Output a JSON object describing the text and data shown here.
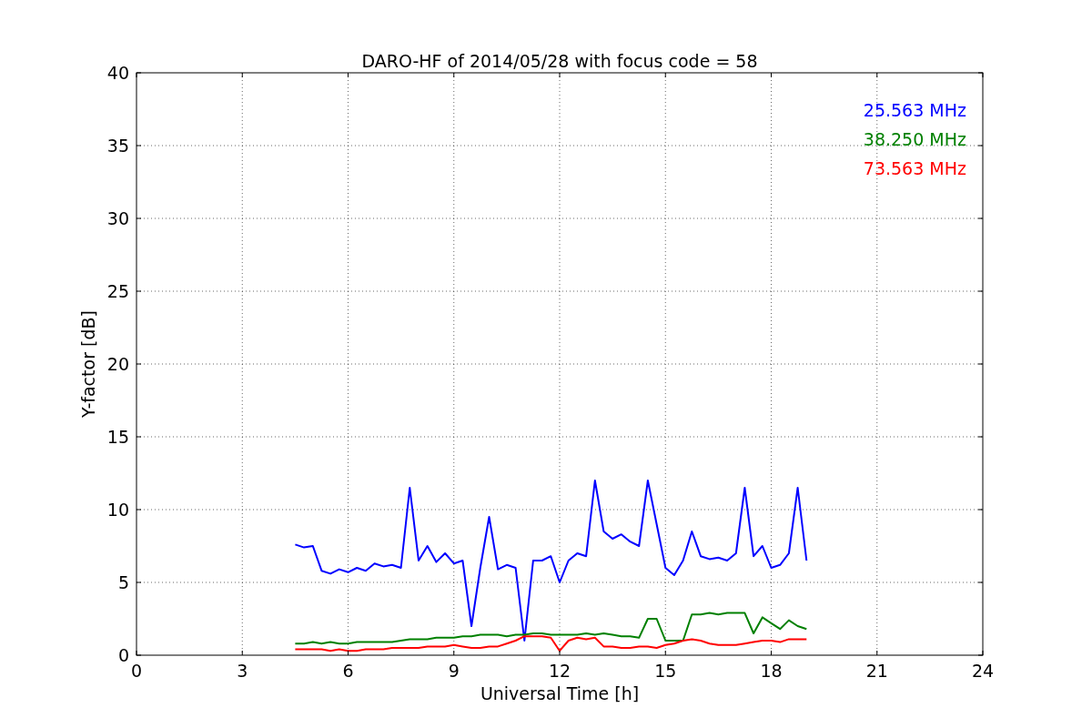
{
  "figure": {
    "chart_data": {
      "type": "line",
      "title": "DARO-HF of 2014/05/28 with focus code = 58",
      "xlabel": "Universal Time [h]",
      "ylabel": "Y-factor [dB]",
      "x": [
        4.5,
        4.75,
        5.0,
        5.25,
        5.5,
        5.75,
        6.0,
        6.25,
        6.5,
        6.75,
        7.0,
        7.25,
        7.5,
        7.75,
        8.0,
        8.25,
        8.5,
        8.75,
        9.0,
        9.25,
        9.5,
        9.75,
        10.0,
        10.25,
        10.5,
        10.75,
        11.0,
        11.25,
        11.5,
        11.75,
        12.0,
        12.25,
        12.5,
        12.75,
        13.0,
        13.25,
        13.5,
        13.75,
        14.0,
        14.25,
        14.5,
        14.75,
        15.0,
        15.25,
        15.5,
        15.75,
        16.0,
        16.25,
        16.5,
        16.75,
        17.0,
        17.25,
        17.5,
        17.75,
        18.0,
        18.25,
        18.5,
        18.75,
        19.0
      ],
      "series": [
        {
          "name": "25.563 MHz",
          "color": "#0000ff",
          "values": [
            7.6,
            7.4,
            7.5,
            5.8,
            5.6,
            5.9,
            5.7,
            6.0,
            5.8,
            6.3,
            6.1,
            6.2,
            6.0,
            11.5,
            6.5,
            7.5,
            6.4,
            7.0,
            6.3,
            6.5,
            2.0,
            6.0,
            9.5,
            5.9,
            6.2,
            6.0,
            1.0,
            6.5,
            6.5,
            6.8,
            5.0,
            6.5,
            7.0,
            6.8,
            12.0,
            8.5,
            8.0,
            8.3,
            7.8,
            7.5,
            12.0,
            9.0,
            6.0,
            5.5,
            6.5,
            8.5,
            6.8,
            6.6,
            6.7,
            6.5,
            7.0,
            11.5,
            6.8,
            7.5,
            6.0,
            6.2,
            7.0,
            11.5,
            6.5
          ]
        },
        {
          "name": "38.250 MHz",
          "color": "#008000",
          "values": [
            0.8,
            0.8,
            0.9,
            0.8,
            0.9,
            0.8,
            0.8,
            0.9,
            0.9,
            0.9,
            0.9,
            0.9,
            1.0,
            1.1,
            1.1,
            1.1,
            1.2,
            1.2,
            1.2,
            1.3,
            1.3,
            1.4,
            1.4,
            1.4,
            1.3,
            1.4,
            1.4,
            1.5,
            1.5,
            1.4,
            1.4,
            1.4,
            1.4,
            1.5,
            1.4,
            1.5,
            1.4,
            1.3,
            1.3,
            1.2,
            2.5,
            2.5,
            1.0,
            1.0,
            1.0,
            2.8,
            2.8,
            2.9,
            2.8,
            2.9,
            2.9,
            2.9,
            1.5,
            2.6,
            2.2,
            1.8,
            2.4,
            2.0,
            1.8
          ]
        },
        {
          "name": "73.563 MHz",
          "color": "#ff0000",
          "values": [
            0.4,
            0.4,
            0.4,
            0.4,
            0.3,
            0.4,
            0.3,
            0.3,
            0.4,
            0.4,
            0.4,
            0.5,
            0.5,
            0.5,
            0.5,
            0.6,
            0.6,
            0.6,
            0.7,
            0.6,
            0.5,
            0.5,
            0.6,
            0.6,
            0.8,
            1.0,
            1.3,
            1.3,
            1.3,
            1.2,
            0.3,
            1.0,
            1.2,
            1.1,
            1.2,
            0.6,
            0.6,
            0.5,
            0.5,
            0.6,
            0.6,
            0.5,
            0.7,
            0.8,
            1.0,
            1.1,
            1.0,
            0.8,
            0.7,
            0.7,
            0.7,
            0.8,
            0.9,
            1.0,
            1.0,
            0.9,
            1.1,
            1.1,
            1.1
          ]
        }
      ],
      "grid": true,
      "xlim": [
        0,
        24
      ],
      "ylim": [
        0,
        40
      ],
      "xticks": [
        0,
        3,
        6,
        9,
        12,
        15,
        18,
        21,
        24
      ],
      "yticks": [
        0,
        5,
        10,
        15,
        20,
        25,
        30,
        35,
        40
      ]
    }
  }
}
